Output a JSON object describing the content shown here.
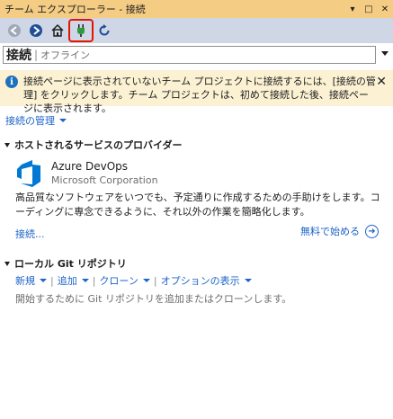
{
  "window": {
    "title": "チーム エクスプローラー - 接続",
    "pin_glyph": "▾",
    "dock_glyph": "□",
    "close_glyph": "✕"
  },
  "toolbar": {
    "items": [
      "back-icon",
      "forward-icon",
      "home-icon",
      "plug-icon",
      "refresh-icon"
    ]
  },
  "header": {
    "title": "接続",
    "subtitle": "オフライン"
  },
  "info": {
    "icon": "i",
    "text": "接続ページに表示されていないチーム プロジェクトに接続するには、[接続の管理] をクリックします。チーム プロジェクトは、初めて接続した後、接続ページに表示されます。",
    "close": "✕"
  },
  "manage": {
    "label": "接続の管理"
  },
  "hosted": {
    "heading": "ホストされるサービスのプロバイダー",
    "provider_name": "Azure DevOps",
    "provider_company": "Microsoft Corporation",
    "description": "高品質なソフトウェアをいつでも、予定通りに作成するための手助けをします。コーディングに専念できるように、それ以外の作業を簡略化します。",
    "connect_label": "接続...",
    "free_start_label": "無料で始める"
  },
  "git": {
    "heading": "ローカル Git リポジトリ",
    "actions": {
      "new": "新規",
      "add": "追加",
      "clone": "クローン",
      "options": "オプションの表示"
    },
    "note": "開始するために Git リポジトリを追加またはクローンします。"
  },
  "colors": {
    "titlebar": "#f5cc84",
    "toolbar": "#cfd6e5",
    "infobar": "#fcf2d3",
    "link": "#1e64c8",
    "highlight": "#e51400",
    "azure": "#0078d4"
  }
}
